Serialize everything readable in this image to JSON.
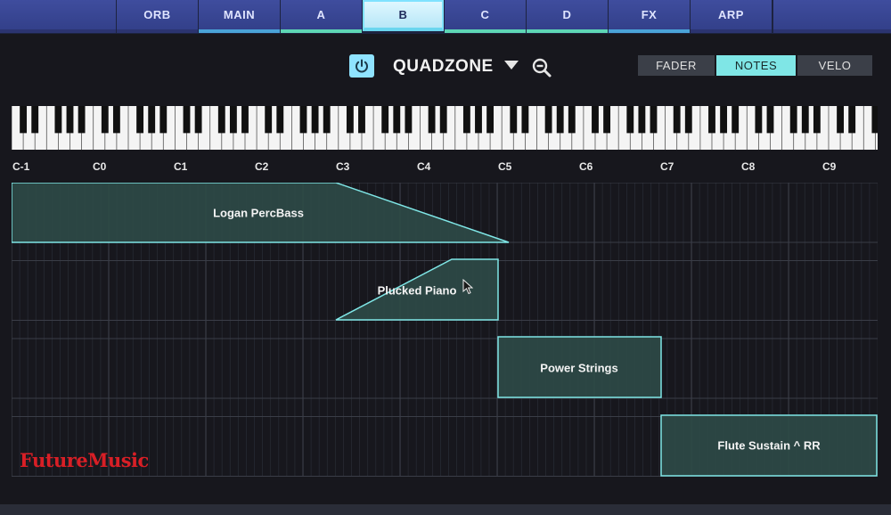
{
  "tabs": [
    {
      "label": "ORB",
      "indicator": ""
    },
    {
      "label": "MAIN",
      "indicator": "#4aa3d8"
    },
    {
      "label": "A",
      "indicator": "#5ed6b5"
    },
    {
      "label": "B",
      "indicator": "#6ad6ef",
      "active": true
    },
    {
      "label": "C",
      "indicator": "#5ed6b5"
    },
    {
      "label": "D",
      "indicator": "#5ed6b5"
    },
    {
      "label": "FX",
      "indicator": "#4aa3d8"
    },
    {
      "label": "ARP",
      "indicator": ""
    }
  ],
  "header": {
    "preset_name": "QUADZONE",
    "power_icon": "power-icon",
    "zoom_icon": "zoom-out-icon",
    "dropdown_icon": "triangle-down-icon"
  },
  "modes": [
    "FADER",
    "NOTES",
    "VELO"
  ],
  "selected_mode": "NOTES",
  "octaves": [
    "C-1",
    "C0",
    "C1",
    "C2",
    "C3",
    "C4",
    "C5",
    "C6",
    "C7",
    "C8",
    "C9"
  ],
  "zones": [
    {
      "name": "Logan PercBass"
    },
    {
      "name": "Plucked Piano"
    },
    {
      "name": "Power Strings"
    },
    {
      "name": "Flute Sustain ^ RR"
    }
  ],
  "logo": "FutureMusic",
  "colors": {
    "zone_fill": "#2e4a46",
    "zone_stroke": "#7fe6e6",
    "accent": "#8fe3ff"
  }
}
